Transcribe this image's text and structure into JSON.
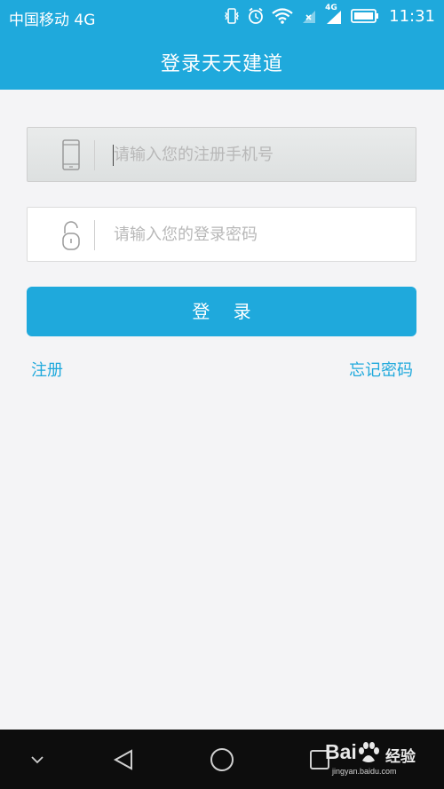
{
  "status_bar": {
    "carrier": "中国移动 4G",
    "network_badge": "4G",
    "time": "11:31",
    "icons": [
      "vibrate-icon",
      "alarm-icon",
      "wifi-icon",
      "no-sim-icon",
      "signal-icon",
      "battery-icon"
    ]
  },
  "header": {
    "title": "登录天天建道"
  },
  "form": {
    "phone_placeholder": "请输入您的注册手机号",
    "phone_value": "",
    "password_placeholder": "请输入您的登录密码",
    "password_value": "",
    "login_label": "登 录",
    "register_label": "注册",
    "forgot_label": "忘记密码"
  },
  "nav_bar": {
    "icons": [
      "chevron-down-icon",
      "back-icon",
      "home-icon",
      "recents-icon"
    ]
  },
  "watermark": {
    "brand": "Bai",
    "brand_suffix": "经验",
    "url": "jingyan.baidu.com"
  },
  "colors": {
    "accent": "#1fa9dc",
    "background": "#f4f4f6",
    "nav_bar": "#0d0d0d",
    "placeholder": "#b8b8b8"
  }
}
